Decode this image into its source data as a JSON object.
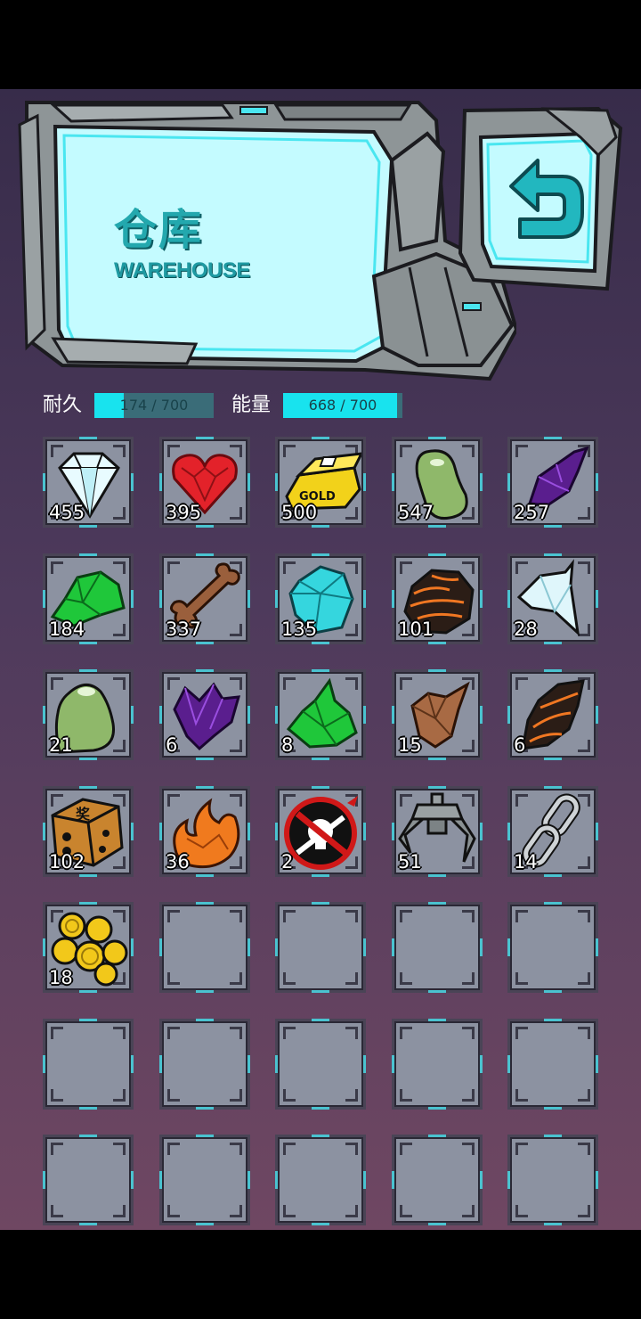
{
  "header": {
    "title_cn": "仓库",
    "title_en": "WAREHOUSE"
  },
  "stats": {
    "durability": {
      "label": "耐久",
      "text": "174 / 700",
      "current": 174,
      "max": 700
    },
    "energy": {
      "label": "能量",
      "text": "668 / 700",
      "current": 668,
      "max": 700
    }
  },
  "colors": {
    "bar_fill": "#18e3ee",
    "bar_track": "#3a6c78",
    "title": "#23a8ae",
    "panel": "#c4fbff"
  },
  "inventory": {
    "slots": [
      {
        "icon": "diamond-icon",
        "count": "455"
      },
      {
        "icon": "red-crystal-heart-icon",
        "count": "395"
      },
      {
        "icon": "gold-bar-icon",
        "count": "500"
      },
      {
        "icon": "green-bean-icon",
        "count": "547"
      },
      {
        "icon": "purple-crystal-shard-icon",
        "count": "257"
      },
      {
        "icon": "green-crystal-icon",
        "count": "184"
      },
      {
        "icon": "bone-icon",
        "count": "337"
      },
      {
        "icon": "cyan-crystal-icon",
        "count": "135"
      },
      {
        "icon": "lava-rock-icon",
        "count": "101"
      },
      {
        "icon": "ice-shard-icon",
        "count": "28"
      },
      {
        "icon": "green-slime-icon",
        "count": "21"
      },
      {
        "icon": "purple-claw-crystal-icon",
        "count": "6"
      },
      {
        "icon": "green-crystal-spike-icon",
        "count": "8"
      },
      {
        "icon": "brown-rock-icon",
        "count": "15"
      },
      {
        "icon": "lava-shard-icon",
        "count": "6"
      },
      {
        "icon": "dice-icon",
        "count": "102"
      },
      {
        "icon": "orange-flame-crystal-icon",
        "count": "36"
      },
      {
        "icon": "no-skull-icon",
        "count": "2"
      },
      {
        "icon": "claw-grabber-icon",
        "count": "51"
      },
      {
        "icon": "chain-link-icon",
        "count": "14"
      },
      {
        "icon": "gold-coins-icon",
        "count": "18"
      },
      {
        "icon": "empty-slot",
        "count": ""
      },
      {
        "icon": "empty-slot",
        "count": ""
      },
      {
        "icon": "empty-slot",
        "count": ""
      },
      {
        "icon": "empty-slot",
        "count": ""
      },
      {
        "icon": "empty-slot",
        "count": ""
      },
      {
        "icon": "empty-slot",
        "count": ""
      },
      {
        "icon": "empty-slot",
        "count": ""
      },
      {
        "icon": "empty-slot",
        "count": ""
      },
      {
        "icon": "empty-slot",
        "count": ""
      },
      {
        "icon": "empty-slot",
        "count": ""
      },
      {
        "icon": "empty-slot",
        "count": ""
      },
      {
        "icon": "empty-slot",
        "count": ""
      },
      {
        "icon": "empty-slot",
        "count": ""
      },
      {
        "icon": "empty-slot",
        "count": ""
      }
    ]
  }
}
